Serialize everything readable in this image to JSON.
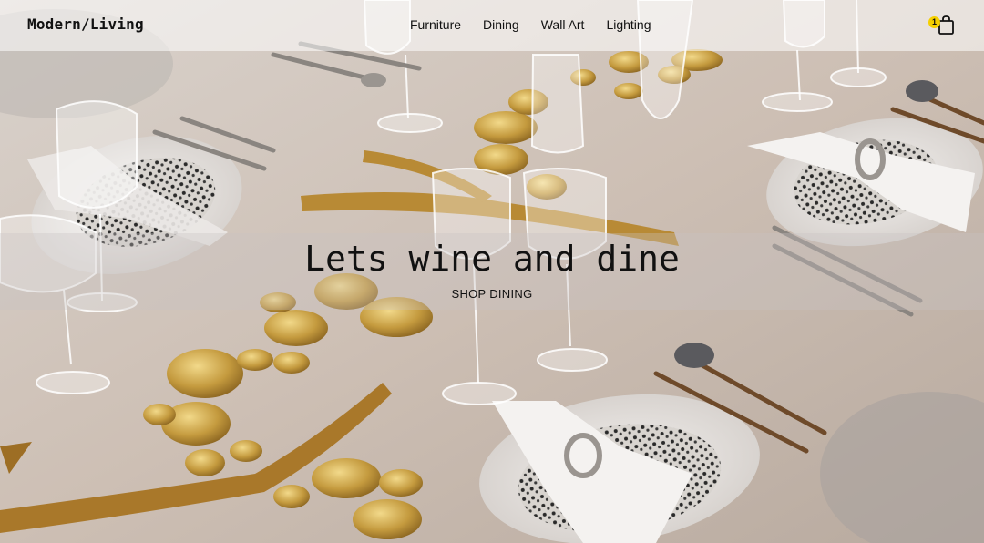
{
  "brand": {
    "logo": "Modern/Living"
  },
  "nav": {
    "items": [
      "Furniture",
      "Dining",
      "Wall Art",
      "Lighting"
    ]
  },
  "cart": {
    "count": "1",
    "icon": "shopping-bag-icon"
  },
  "hero": {
    "headline": "Lets wine and dine",
    "cta_label": "SHOP DINING",
    "image_subject": "dining-table-place-settings-photo"
  },
  "colors": {
    "badge": "#f5d000",
    "text": "#111111",
    "gold": "#c9a24a"
  }
}
